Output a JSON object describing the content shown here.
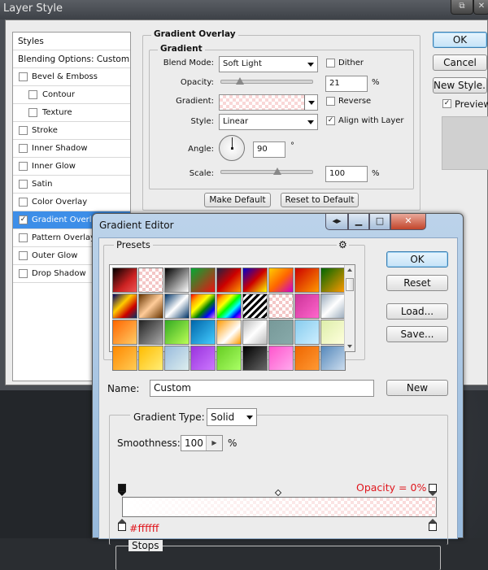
{
  "layer_style": {
    "title": "Layer Style",
    "styles_list": [
      {
        "label": "Styles",
        "type": "head",
        "checked": false
      },
      {
        "label": "Blending Options: Custom",
        "type": "head",
        "checked": false
      },
      {
        "label": "Bevel & Emboss",
        "type": "check",
        "checked": false
      },
      {
        "label": "Contour",
        "type": "sub",
        "checked": false
      },
      {
        "label": "Texture",
        "type": "sub",
        "checked": false
      },
      {
        "label": "Stroke",
        "type": "check",
        "checked": false
      },
      {
        "label": "Inner Shadow",
        "type": "check",
        "checked": false
      },
      {
        "label": "Inner Glow",
        "type": "check",
        "checked": false
      },
      {
        "label": "Satin",
        "type": "check",
        "checked": false
      },
      {
        "label": "Color Overlay",
        "type": "check",
        "checked": false
      },
      {
        "label": "Gradient Overlay",
        "type": "check",
        "checked": true,
        "selected": true
      },
      {
        "label": "Pattern Overlay",
        "type": "check",
        "checked": false
      },
      {
        "label": "Outer Glow",
        "type": "check",
        "checked": false
      },
      {
        "label": "Drop Shadow",
        "type": "check",
        "checked": false
      }
    ],
    "section_title": "Gradient Overlay",
    "group_title": "Gradient",
    "blend_mode_label": "Blend Mode:",
    "blend_mode_value": "Soft Light",
    "dither_label": "Dither",
    "opacity_label": "Opacity:",
    "opacity_value": "21",
    "opacity_unit": "%",
    "gradient_label": "Gradient:",
    "reverse_label": "Reverse",
    "style_label": "Style:",
    "style_value": "Linear",
    "align_label": "Align with Layer",
    "angle_label": "Angle:",
    "angle_value": "90",
    "angle_unit": "°",
    "scale_label": "Scale:",
    "scale_value": "100",
    "scale_unit": "%",
    "make_default": "Make Default",
    "reset_default": "Reset to Default",
    "ok": "OK",
    "cancel": "Cancel",
    "new_style": "New Style...",
    "preview_label": "Preview"
  },
  "gradient_editor": {
    "title": "Gradient Editor",
    "presets_label": "Presets",
    "ok": "OK",
    "reset": "Reset",
    "load": "Load...",
    "save": "Save...",
    "name_label": "Name:",
    "name_value": "Custom",
    "new_button": "New",
    "gradient_type_label": "Gradient Type:",
    "gradient_type_value": "Solid",
    "smoothness_label": "Smoothness:",
    "smoothness_value": "100",
    "smoothness_unit": "%",
    "opacity_annotation": "Opacity = 0%",
    "color_annotation": "#ffffff",
    "stops_label": "Stops"
  }
}
